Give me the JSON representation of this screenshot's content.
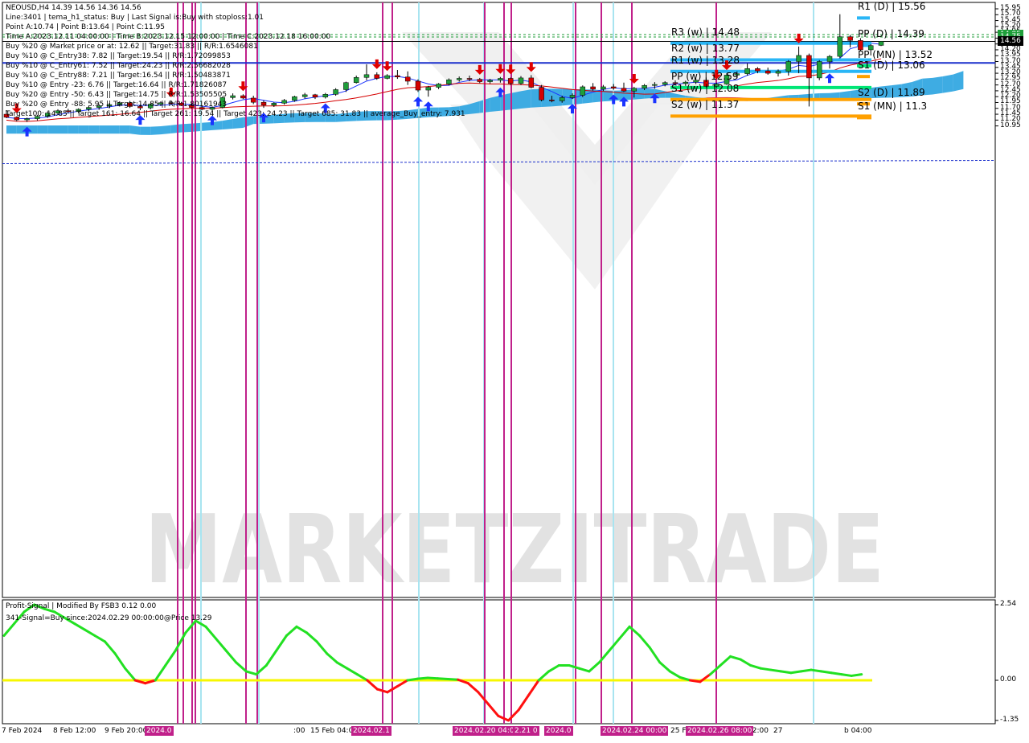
{
  "symbol_header": "NEOUSD,H4  14.39 14.56 14.36 14.56",
  "info_lines": [
    "Line:3401 | tema_h1_status: Buy | Last Signal is:Buy with stoploss:1.01",
    "Point A:10.74 | Point B:13.64 | Point C:11.95",
    "Time A:2023.12.11 04:00:00 | Time B:2023.12.15 12:00:00 | Time C:2023.12.18 16:00:00",
    "Buy %20 @ Market price or at: 12.62 || Target:31.83 || R/R:1.6546081",
    "Buy %10 @ C_Entry38: 7.82 || Target:19.54 || R/R:1.72099853",
    "Buy %10 @ C_Entry61: 7.52 || Target:24.23 || R/R:2.56682028",
    "Buy %10 @ C_Entry88: 7.21 || Target:16.54 || R/R:1.50483871",
    "Buy %10 @ Entry -23: 6.76 || Target:16.64 || R/R:1.71826087",
    "Buy %20 @ Entry -50: 6.43 || Target:14.75 || R/R:1.53505505",
    "Buy %20 @ Entry -88: 5.95 || Target:14.85 || R/R:1.80161943",
    "Target100: 14.85 || Target 161: 16.64 || Target 261: 19.54 || Target 423: 24.23 || Target 685: 31.83 || average_Buy_entry: 7.931"
  ],
  "subwindow": {
    "title": "Profit-Signal | Modified By FSB3 0.12 0.00",
    "signal_text": "341-Signal=Buy since:2024.02.29 00:00:00@Price 13.29",
    "y_ticks": [
      "2.54",
      "0.00",
      "-1.35"
    ],
    "y_values": [
      2.54,
      0.0,
      -1.35
    ],
    "ylim": [
      -1.5,
      2.7
    ]
  },
  "levels": [
    {
      "label": "R1 (D) | 15.56",
      "value": 15.56,
      "color": "#29b6f6"
    },
    {
      "label": "PP (D) | 14.39",
      "value": 14.39,
      "color": "#29b6f6"
    },
    {
      "label": "R3 (w) | 14.48",
      "value": 14.48,
      "color": "#29b6f6"
    },
    {
      "label": "R2 (w) | 13.77",
      "value": 13.77,
      "color": "#29b6f6"
    },
    {
      "label": "PP (MN) | 13.52",
      "value": 13.52,
      "color": "#00e676"
    },
    {
      "label": "R1 (w) | 13.28",
      "value": 13.28,
      "color": "#29b6f6"
    },
    {
      "label": "S1 (D) | 13.06",
      "value": 13.06,
      "color": "#ffa000"
    },
    {
      "label": "PP (w) | 12.59",
      "value": 12.59,
      "color": "#00e676"
    },
    {
      "label": "S1 (w) | 12.08",
      "value": 12.08,
      "color": "#ffa000"
    },
    {
      "label": "S2 (D) | 11.89",
      "value": 11.89,
      "color": "#ffa000"
    },
    {
      "label": "S2 (w) | 11.37",
      "value": 11.37,
      "color": "#ffa000"
    },
    {
      "label": "S1 (MN) | 11.3",
      "value": 11.3,
      "color": "#ffa000"
    }
  ],
  "price_axis": {
    "ticks": [
      "15.95",
      "15.70",
      "15.45",
      "15.20",
      "14.95",
      "14.70",
      "14.45",
      "14.20",
      "13.95",
      "13.70",
      "13.45",
      "13.20",
      "12.95",
      "12.70",
      "12.45",
      "12.20",
      "11.95",
      "11.70",
      "11.45",
      "11.20",
      "10.95"
    ],
    "tags": [
      {
        "text": "14.85",
        "value": 14.85,
        "bg": "#1f9e3a",
        "fg": "#ffffff"
      },
      {
        "text": "14.75",
        "value": 14.75,
        "bg": "#1f9e3a",
        "fg": "#ffffff"
      },
      {
        "text": "14.56",
        "value": 14.56,
        "bg": "#000000",
        "fg": "#ffffff"
      }
    ]
  },
  "time_axis": {
    "labels": [
      "7 Feb 2024",
      "8 Feb 12:00",
      "9 Feb 20:00",
      ":00",
      "15 Feb 04:0",
      "25 F",
      "12:00",
      "27",
      "b 04:00"
    ],
    "markers": [
      "2024.0",
      "2024.02.1",
      "2024.02.20 04:00",
      "2.21 0",
      "2024.0",
      "2024.02.24 00:00",
      "2024.02.26 08:00"
    ]
  },
  "watermark": "MARKETZITRADE",
  "colors": {
    "bull": "#1f9e3a",
    "bear": "#d50000",
    "cloud_up": "#29a3e0",
    "cloud_down": "#d81b36",
    "tenkan": "#1a33ff",
    "kijun": "#d50000",
    "vline_magenta": "#c0208a",
    "vline_cyan": "#a8e4f0",
    "osc_up": "#22e022",
    "osc_down": "#ff1010",
    "zero_line": "#f7f700",
    "h_blue": "#1a2fcc"
  },
  "chart_data": {
    "type": "candlestick",
    "symbol": "NEOUSD",
    "timeframe": "H4",
    "ylim": [
      10.9,
      16.02
    ],
    "candles": [
      [
        11.45,
        11.62,
        11.28,
        11.32
      ],
      [
        11.32,
        11.36,
        11.15,
        11.21
      ],
      [
        11.21,
        11.3,
        11.12,
        11.26
      ],
      [
        11.26,
        11.42,
        11.18,
        11.36
      ],
      [
        11.36,
        11.56,
        11.3,
        11.5
      ],
      [
        11.5,
        11.66,
        11.42,
        11.6
      ],
      [
        11.6,
        11.68,
        11.48,
        11.56
      ],
      [
        11.56,
        11.7,
        11.5,
        11.66
      ],
      [
        11.66,
        11.8,
        11.58,
        11.74
      ],
      [
        11.74,
        11.88,
        11.64,
        11.8
      ],
      [
        11.8,
        11.92,
        11.7,
        11.86
      ],
      [
        11.86,
        12.0,
        11.78,
        11.94
      ],
      [
        11.94,
        12.02,
        11.72,
        11.78
      ],
      [
        11.78,
        11.86,
        11.62,
        11.72
      ],
      [
        11.72,
        11.92,
        11.66,
        11.88
      ],
      [
        11.88,
        12.0,
        11.8,
        11.94
      ],
      [
        11.94,
        12.04,
        11.86,
        11.92
      ],
      [
        11.92,
        11.98,
        11.8,
        11.84
      ],
      [
        11.84,
        11.9,
        11.7,
        11.74
      ],
      [
        11.74,
        11.82,
        11.62,
        11.66
      ],
      [
        11.66,
        11.78,
        11.6,
        11.74
      ],
      [
        11.74,
        12.2,
        11.7,
        12.16
      ],
      [
        12.16,
        12.34,
        12.08,
        12.24
      ],
      [
        12.24,
        12.3,
        12.1,
        12.14
      ],
      [
        12.14,
        12.24,
        11.88,
        11.96
      ],
      [
        11.96,
        12.04,
        11.72,
        11.84
      ],
      [
        11.84,
        11.96,
        11.76,
        11.92
      ],
      [
        11.92,
        12.1,
        11.86,
        12.04
      ],
      [
        12.04,
        12.24,
        11.98,
        12.2
      ],
      [
        12.2,
        12.36,
        12.12,
        12.28
      ],
      [
        12.28,
        12.32,
        12.1,
        12.18
      ],
      [
        12.18,
        12.36,
        12.12,
        12.3
      ],
      [
        12.3,
        12.56,
        12.24,
        12.5
      ],
      [
        12.5,
        12.84,
        12.4,
        12.8
      ],
      [
        12.8,
        13.1,
        12.76,
        13.02
      ],
      [
        13.02,
        13.58,
        12.9,
        13.14
      ],
      [
        13.14,
        13.24,
        12.92,
        12.98
      ],
      [
        12.98,
        13.16,
        12.94,
        13.1
      ],
      [
        13.1,
        13.34,
        12.96,
        13.04
      ],
      [
        13.04,
        13.28,
        12.7,
        12.86
      ],
      [
        12.86,
        12.94,
        12.4,
        12.48
      ],
      [
        12.48,
        12.66,
        12.2,
        12.6
      ],
      [
        12.6,
        12.78,
        12.52,
        12.74
      ],
      [
        12.74,
        12.98,
        12.68,
        12.92
      ],
      [
        12.92,
        13.06,
        12.84,
        12.98
      ],
      [
        12.98,
        13.1,
        12.86,
        12.94
      ],
      [
        12.94,
        13.0,
        12.78,
        12.84
      ],
      [
        12.84,
        12.96,
        12.76,
        12.9
      ],
      [
        12.9,
        13.04,
        12.8,
        12.98
      ],
      [
        12.98,
        13.02,
        12.7,
        12.76
      ],
      [
        12.76,
        13.08,
        12.7,
        13.0
      ],
      [
        13.0,
        13.12,
        12.56,
        12.6
      ],
      [
        12.6,
        12.7,
        12.0,
        12.06
      ],
      [
        12.06,
        12.24,
        11.96,
        12.02
      ],
      [
        12.02,
        12.24,
        11.94,
        12.16
      ],
      [
        12.16,
        12.34,
        12.1,
        12.26
      ],
      [
        12.26,
        12.68,
        12.18,
        12.62
      ],
      [
        12.62,
        12.78,
        12.46,
        12.52
      ],
      [
        12.52,
        12.7,
        12.44,
        12.62
      ],
      [
        12.62,
        12.74,
        12.5,
        12.56
      ],
      [
        12.56,
        12.8,
        12.4,
        12.44
      ],
      [
        12.44,
        12.62,
        12.16,
        12.56
      ],
      [
        12.56,
        12.74,
        12.48,
        12.68
      ],
      [
        12.68,
        12.82,
        12.54,
        12.72
      ],
      [
        12.72,
        12.86,
        12.64,
        12.8
      ],
      [
        12.8,
        12.9,
        12.7,
        12.76
      ],
      [
        12.76,
        12.88,
        12.66,
        12.82
      ],
      [
        12.82,
        12.98,
        12.74,
        12.9
      ],
      [
        12.9,
        13.02,
        12.6,
        12.64
      ],
      [
        12.64,
        12.8,
        12.56,
        12.74
      ],
      [
        12.74,
        13.2,
        12.7,
        13.12
      ],
      [
        13.12,
        13.28,
        12.98,
        13.18
      ],
      [
        13.18,
        13.62,
        13.1,
        13.4
      ],
      [
        13.4,
        13.46,
        13.2,
        13.3
      ],
      [
        13.3,
        13.44,
        13.14,
        13.2
      ],
      [
        13.2,
        13.36,
        13.06,
        13.28
      ],
      [
        13.28,
        13.76,
        13.1,
        13.7
      ],
      [
        13.7,
        14.34,
        13.2,
        13.96
      ],
      [
        13.96,
        14.04,
        11.78,
        13.0
      ],
      [
        13.0,
        13.76,
        12.9,
        13.7
      ],
      [
        13.7,
        13.98,
        13.4,
        13.92
      ],
      [
        13.92,
        15.72,
        13.84,
        14.76
      ],
      [
        14.76,
        14.84,
        14.3,
        14.6
      ],
      [
        14.6,
        14.7,
        14.16,
        14.2
      ],
      [
        14.2,
        14.44,
        13.96,
        14.38
      ],
      [
        14.39,
        14.56,
        14.36,
        14.56
      ]
    ],
    "oscillator": [
      1.5,
      1.9,
      2.3,
      2.54,
      2.4,
      2.3,
      2.1,
      1.9,
      1.7,
      1.5,
      1.3,
      0.9,
      0.4,
      0.0,
      -0.1,
      0.0,
      0.5,
      1.0,
      1.6,
      2.0,
      1.8,
      1.4,
      1.0,
      0.6,
      0.3,
      0.2,
      0.5,
      1.0,
      1.5,
      1.8,
      1.6,
      1.3,
      0.9,
      0.6,
      0.4,
      0.2,
      0.0,
      -0.3,
      -0.4,
      -0.2,
      0.0,
      0.05,
      0.08,
      0.06,
      0.04,
      0.02,
      -0.1,
      -0.4,
      -0.8,
      -1.2,
      -1.35,
      -1.0,
      -0.5,
      0.0,
      0.3,
      0.5,
      0.5,
      0.4,
      0.3,
      0.6,
      1.0,
      1.4,
      1.8,
      1.5,
      1.1,
      0.6,
      0.3,
      0.1,
      0.0,
      -0.05,
      0.2,
      0.5,
      0.8,
      0.7,
      0.5,
      0.4,
      0.35,
      0.3,
      0.25,
      0.3,
      0.35,
      0.3,
      0.25,
      0.2,
      0.15,
      0.2
    ]
  }
}
